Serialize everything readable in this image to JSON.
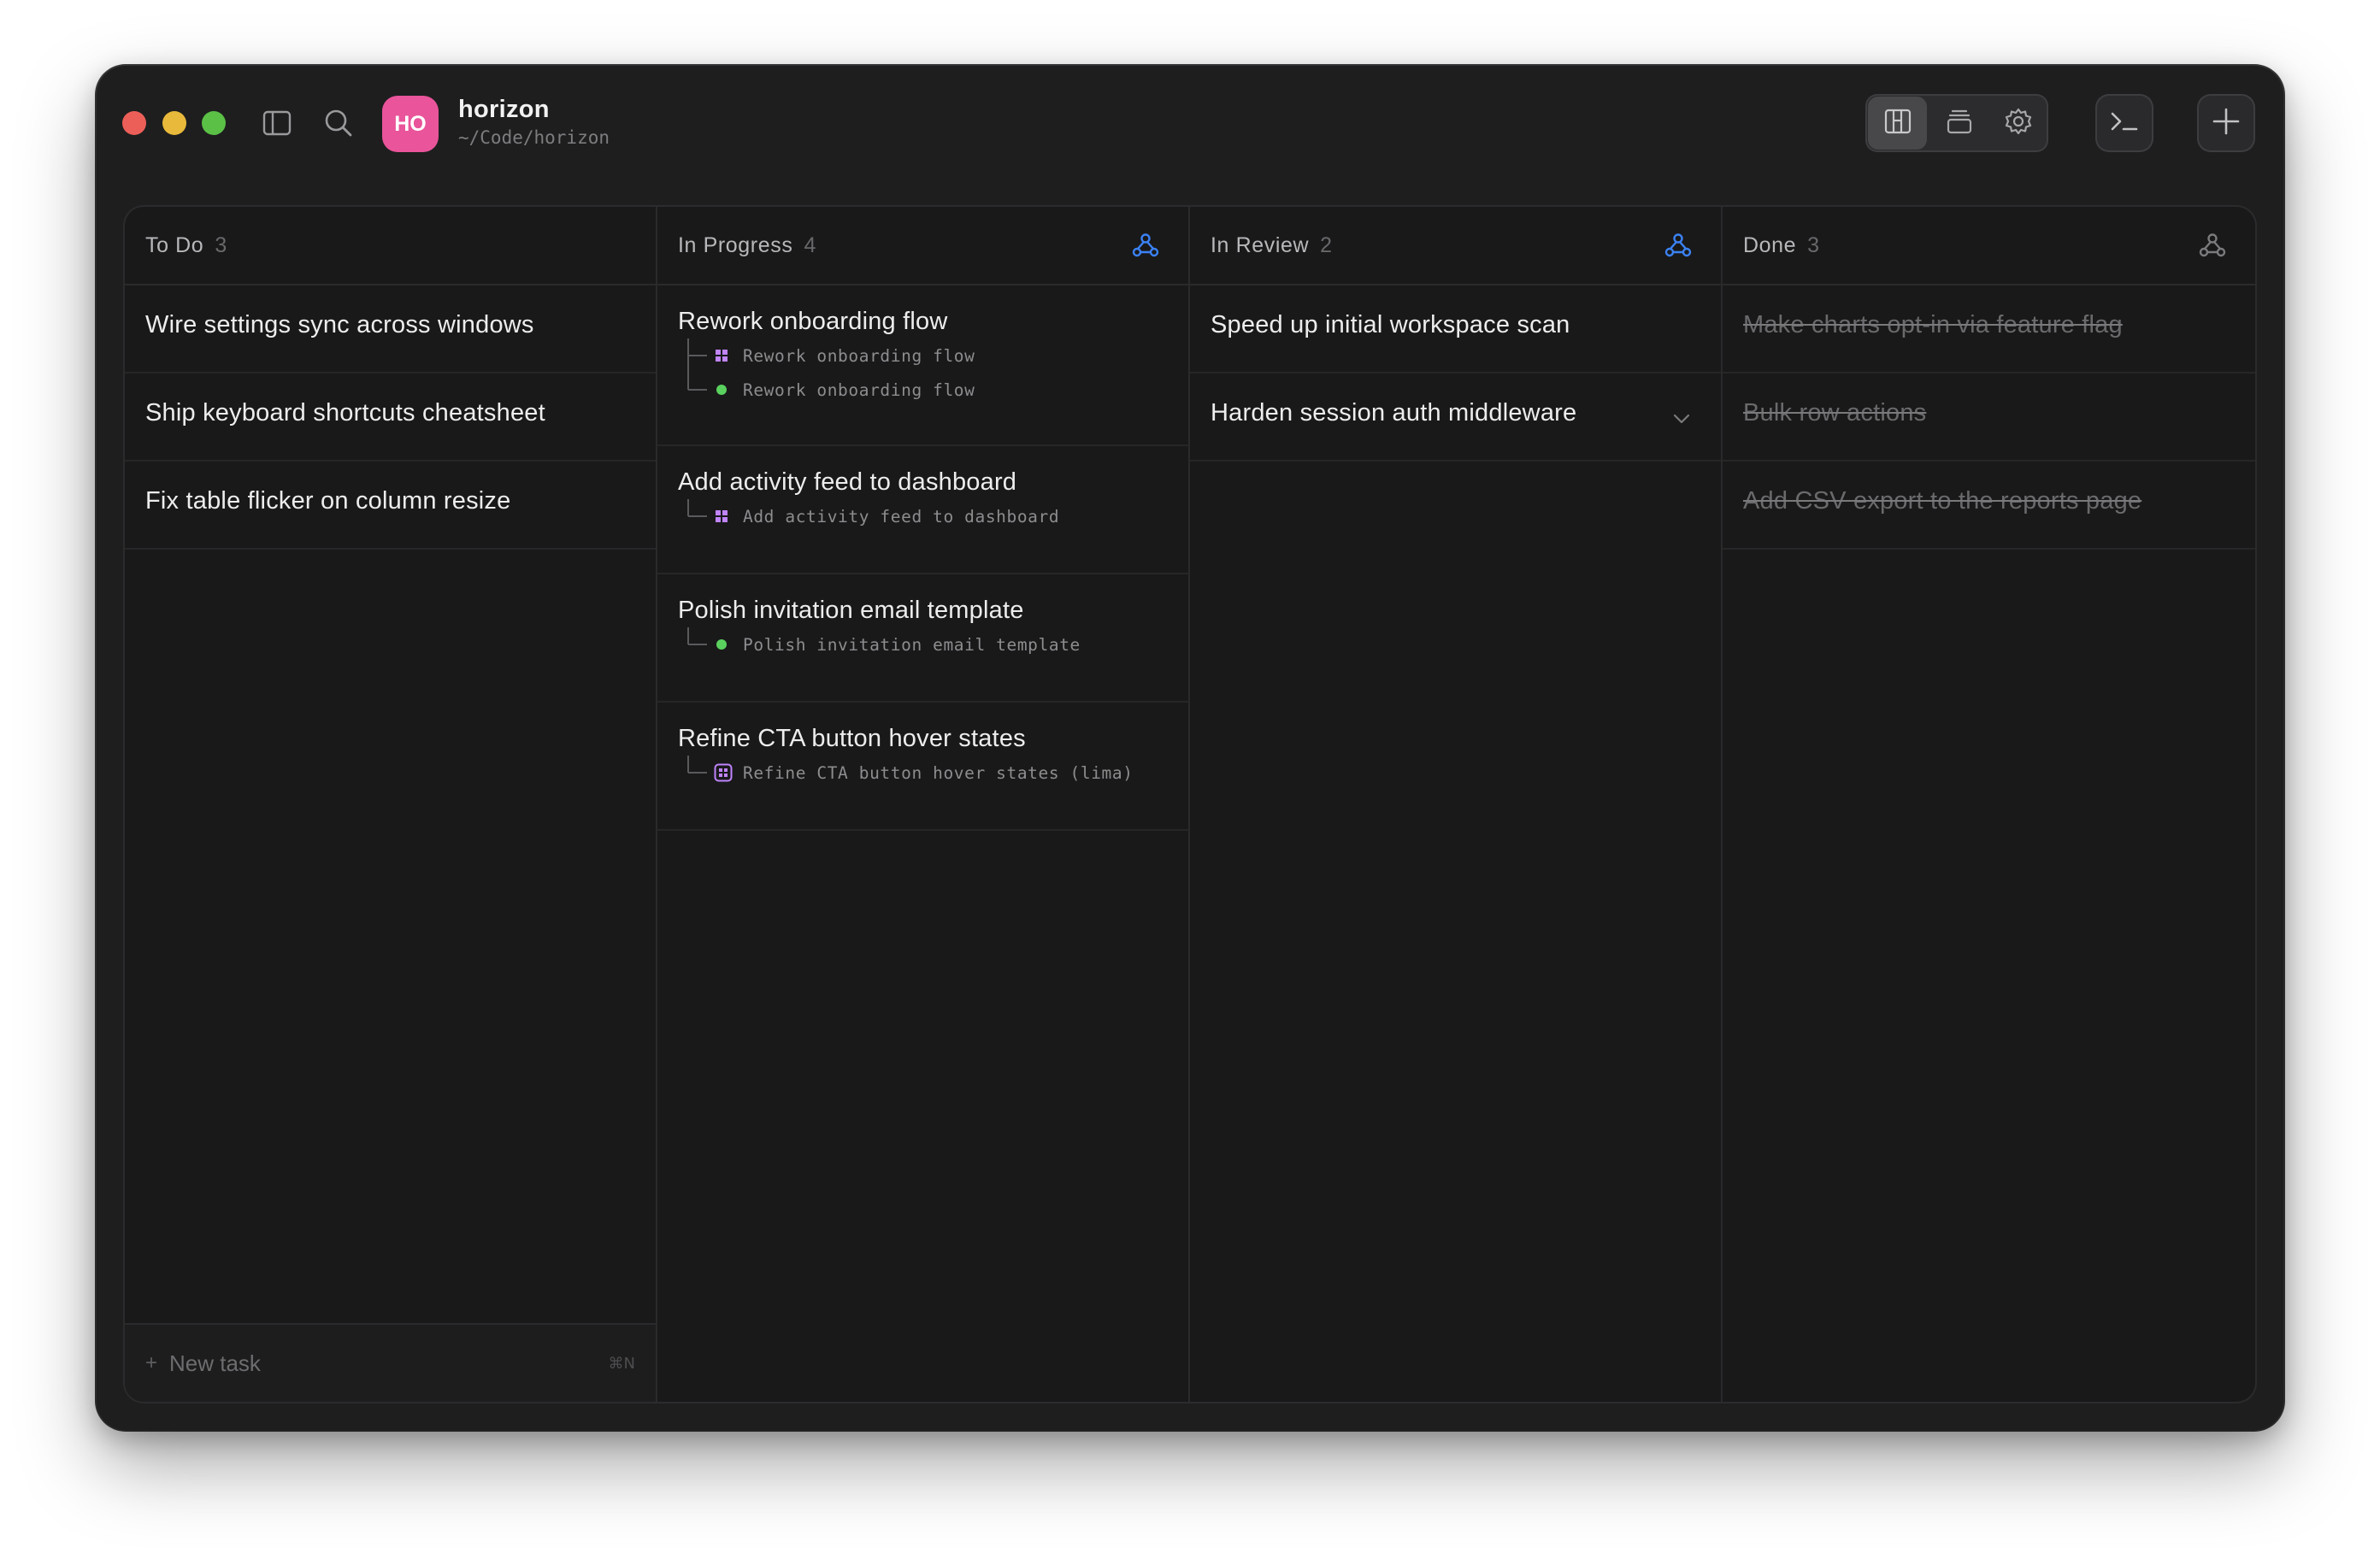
{
  "app": {
    "project_initials": "HO",
    "project_name": "horizon",
    "project_path": "~/Code/horizon"
  },
  "colors": {
    "avatar": "#e9549a",
    "accent_blue": "#3b82f6",
    "status_green": "#5ad15e",
    "badge_purple": "#c084fc"
  },
  "toolbar": {
    "sidebar_icon": "sidebar-toggle-icon",
    "search_icon": "search-icon",
    "board_view_icon": "board-view-icon",
    "stack_view_icon": "stack-view-icon",
    "settings_icon": "gear-icon",
    "terminal_icon": "terminal-icon",
    "add_icon": "plus-icon"
  },
  "columns": [
    {
      "title": "To Do",
      "count": "3",
      "cards": [
        {
          "title": "Wire settings sync across windows"
        },
        {
          "title": "Ship keyboard shortcuts cheatsheet"
        },
        {
          "title": "Fix table flicker on column resize"
        }
      ],
      "new_task": {
        "label": "New task",
        "shortcut": "⌘N"
      }
    },
    {
      "title": "In Progress",
      "count": "4",
      "cards": [
        {
          "title": "Rework onboarding flow",
          "subs": [
            {
              "icon": "grid",
              "text": "Rework onboarding flow"
            },
            {
              "icon": "dot",
              "text": "Rework onboarding flow"
            }
          ]
        },
        {
          "title": "Add activity feed to dashboard",
          "subs": [
            {
              "icon": "grid",
              "text": "Add activity feed to dashboard"
            }
          ]
        },
        {
          "title": "Polish invitation email template",
          "subs": [
            {
              "icon": "dot",
              "text": "Polish invitation email template"
            }
          ]
        },
        {
          "title": "Refine CTA button hover states",
          "subs": [
            {
              "icon": "box",
              "text": "Refine CTA button hover states (lima)"
            }
          ]
        }
      ]
    },
    {
      "title": "In Review",
      "count": "2",
      "cards": [
        {
          "title": "Speed up initial workspace scan"
        },
        {
          "title": "Harden session auth middleware"
        }
      ]
    },
    {
      "title": "Done",
      "count": "3",
      "cards": [
        {
          "title": "Make charts opt-in via feature flag"
        },
        {
          "title": "Bulk row actions"
        },
        {
          "title": "Add CSV export to the reports page"
        }
      ]
    }
  ]
}
